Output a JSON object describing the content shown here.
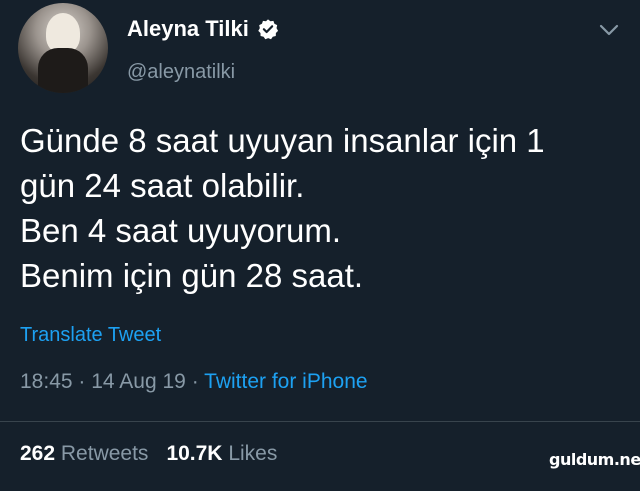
{
  "author": {
    "name": "Aleyna Tilki",
    "handle": "@aleynatilki",
    "verified_icon": "verified-badge-icon"
  },
  "tweet": {
    "lines": [
      "Günde 8 saat uyuyan insanlar için 1",
      "gün 24 saat olabilir.",
      "Ben 4 saat uyuyorum.",
      "Benim için gün 28 saat."
    ],
    "translate_label": "Translate Tweet",
    "time": "18:45",
    "date": "14 Aug 19",
    "separator": "·",
    "source": "Twitter for iPhone"
  },
  "stats": {
    "retweets_count": "262",
    "retweets_label": "Retweets",
    "likes_count": "10.7K",
    "likes_label": "Likes"
  },
  "watermark": "guldum.net",
  "colors": {
    "background": "#15202b",
    "text": "#ffffff",
    "secondary": "#8899a6",
    "link": "#1da1f2",
    "divider": "#38444d"
  }
}
